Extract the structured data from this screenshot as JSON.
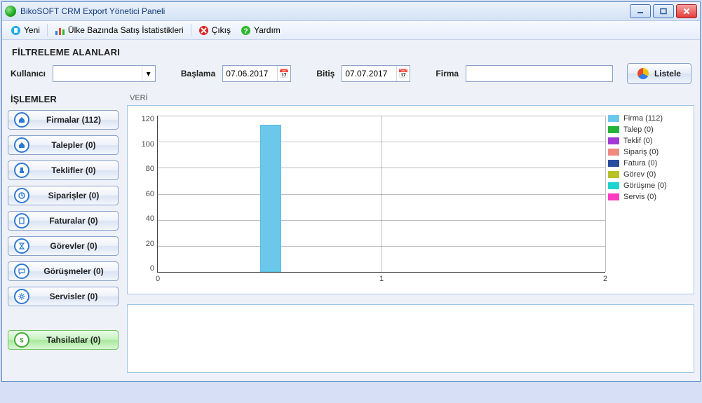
{
  "window": {
    "title": "BikoSOFT CRM Export Yönetici  Paneli"
  },
  "toolbar": {
    "yeni": "Yeni",
    "stats": "Ülke Bazında Satış İstatistikleri",
    "cikis": "Çıkış",
    "yardim": "Yardım"
  },
  "filters": {
    "section_title": "FİLTRELEME ALANLARI",
    "user_label": "Kullanıcı",
    "user_value": "",
    "start_label": "Başlama",
    "start_value": "07.06.2017",
    "end_label": "Bitiş",
    "end_value": "07.07.2017",
    "firm_label": "Firma",
    "firm_value": "",
    "list_button": "Listele"
  },
  "ops": {
    "title": "İŞLEMLER",
    "items": [
      {
        "label": "Firmalar (112)",
        "icon": "home"
      },
      {
        "label": "Talepler (0)",
        "icon": "home"
      },
      {
        "label": "Teklifler (0)",
        "icon": "hand"
      },
      {
        "label": "Siparişler (0)",
        "icon": "clock"
      },
      {
        "label": "Faturalar (0)",
        "icon": "doc"
      },
      {
        "label": "Görevler (0)",
        "icon": "sand"
      },
      {
        "label": "Görüşmeler (0)",
        "icon": "talk"
      },
      {
        "label": "Servisler (0)",
        "icon": "gear"
      }
    ],
    "tahsilat": "Tahsilatlar (0)"
  },
  "chart": {
    "title": "VERİ"
  },
  "chart_data": {
    "type": "bar",
    "x": [
      0.5
    ],
    "values": [
      112
    ],
    "y_ticks": [
      0,
      20,
      40,
      60,
      80,
      100,
      120
    ],
    "x_ticks": [
      0,
      1,
      2
    ],
    "ylim": [
      0,
      120
    ],
    "xlim": [
      0,
      2
    ],
    "legend": [
      {
        "label": "Firma (112)",
        "color": "#6cc8ea"
      },
      {
        "label": "Talep (0)",
        "color": "#25b23a"
      },
      {
        "label": "Teklif (0)",
        "color": "#a23bd6"
      },
      {
        "label": "Sipariş (0)",
        "color": "#ef8a7e"
      },
      {
        "label": "Fatura (0)",
        "color": "#2a4c9b"
      },
      {
        "label": "Görev (0)",
        "color": "#b8c226"
      },
      {
        "label": "Görüşme (0)",
        "color": "#1fd4cf"
      },
      {
        "label": "Servis (0)",
        "color": "#ff3bc3"
      }
    ]
  }
}
